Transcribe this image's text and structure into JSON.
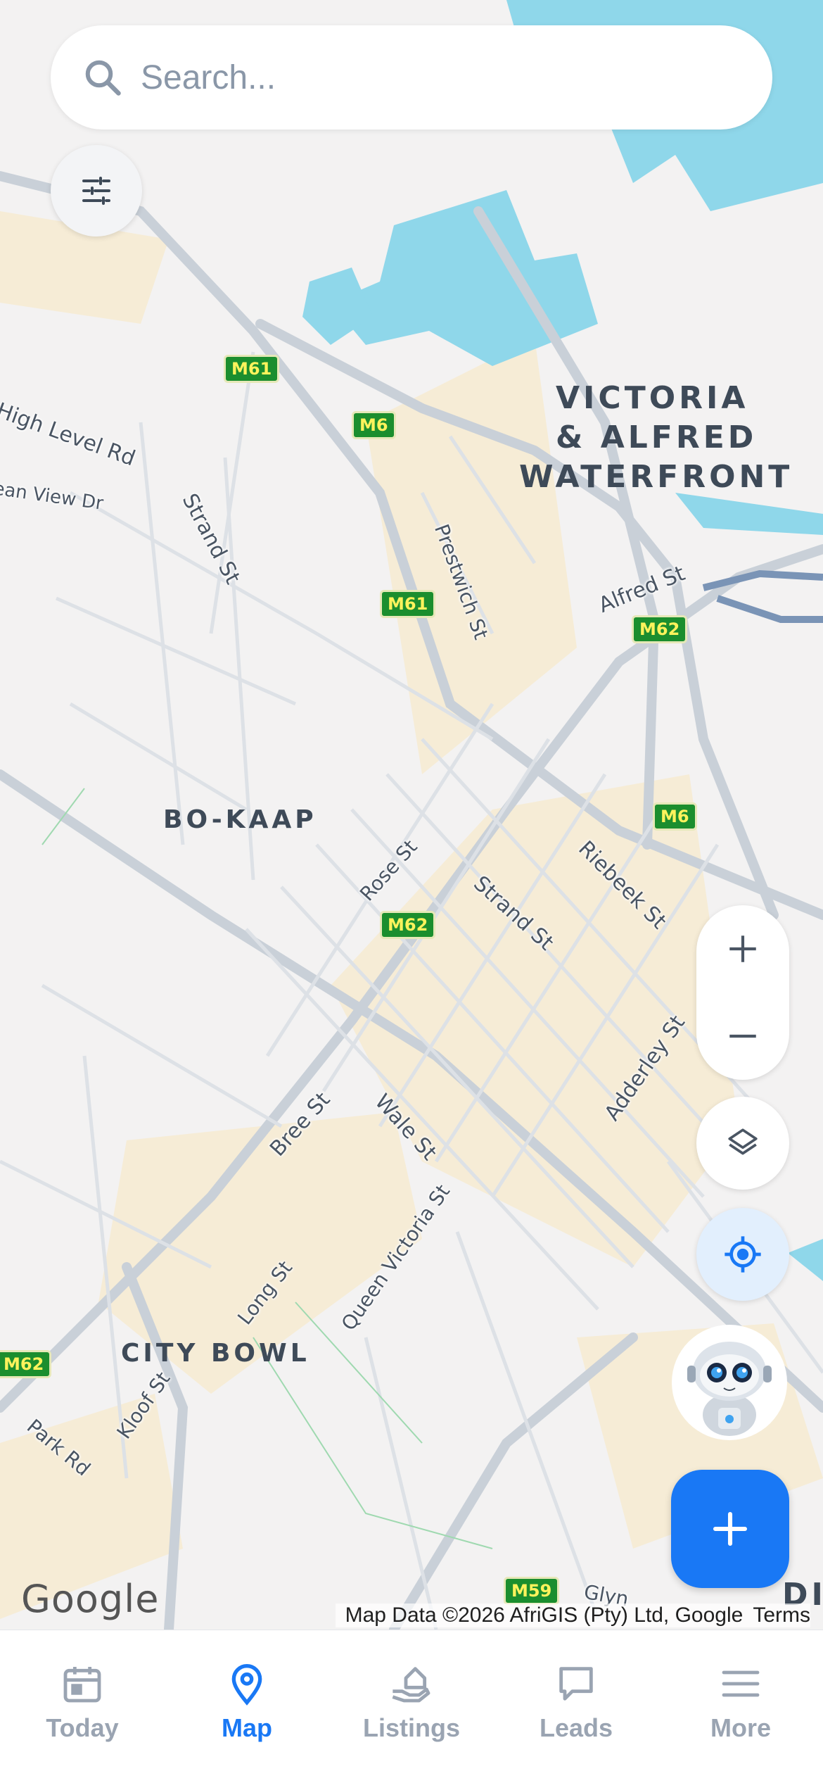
{
  "search": {
    "placeholder": "Search...",
    "icon": "search-icon"
  },
  "map": {
    "areas": [
      "VICTORIA",
      "& ALFRED",
      "WATERFRONT",
      "BO-KAAP",
      "CITY BOWL",
      "DIST"
    ],
    "streets": [
      "High Level Rd",
      "ean View Dr",
      "Strand St",
      "Prestwich St",
      "Alfred St",
      "Rose St",
      "Strand St",
      "Riebeek St",
      "Adderley St",
      "Bree St",
      "Wale St",
      "Queen Victoria St",
      "Long St",
      "Kloof St",
      "Park Rd",
      "Glyn"
    ],
    "shields": [
      "M61",
      "M6",
      "M61",
      "M62",
      "M6",
      "M62",
      "M62",
      "M59"
    ],
    "google_logo": "Google",
    "attribution": "Map Data ©2026 AfriGIS (Pty) Ltd, Google",
    "terms": "Terms",
    "colors": {
      "water": "#8fd7ea",
      "urban": "#f6ecd6",
      "road": "#c9d0d8",
      "shield": "#1b8e2e"
    }
  },
  "controls": {
    "zoom_in": "+",
    "zoom_out": "−",
    "fab_label": "+",
    "accent": "#1978f5"
  },
  "tabs": [
    {
      "label": "Today",
      "icon": "calendar-icon",
      "active": false
    },
    {
      "label": "Map",
      "icon": "map-pin-icon",
      "active": true
    },
    {
      "label": "Listings",
      "icon": "hand-house-icon",
      "active": false
    },
    {
      "label": "Leads",
      "icon": "chat-bubble-icon",
      "active": false
    },
    {
      "label": "More",
      "icon": "menu-icon",
      "active": false
    }
  ]
}
